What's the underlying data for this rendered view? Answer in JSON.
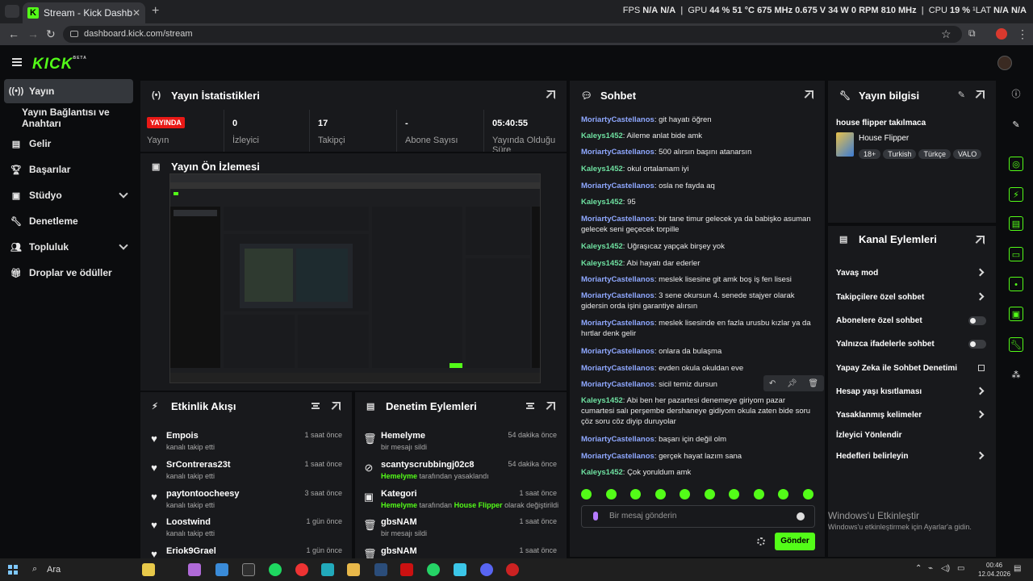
{
  "browser": {
    "tab_title": "Stream - Kick Dashboard",
    "tab_icon": "K",
    "url": "dashboard.kick.com/stream",
    "overlay": {
      "fps_label": "FPS",
      "fps": "N/A",
      "fps2": "N/A",
      "gpu_label": "GPU",
      "gpu_load": "44 %",
      "gpu_temp": "51 °C",
      "gpu_clock": "675 MHz",
      "gpu_volt": "0.675 V",
      "gpu_power": "34 W",
      "gpu_fan": "0 RPM",
      "gpu_mem": "810 MHz",
      "cpu_label": "CPU",
      "cpu_load": "19 %",
      "cpu_lat": "¹LAT",
      "cpu_na1": "N/A",
      "cpu_na2": "N/A"
    }
  },
  "app": {
    "logo": "KICK",
    "logo_beta": "BETA"
  },
  "sidebar": {
    "items": [
      {
        "label": "Yayın",
        "icon": "broadcast-icon"
      },
      {
        "label": "Yayın Bağlantısı ve Anahtarı",
        "icon": ""
      },
      {
        "label": "Gelir",
        "icon": "revenue-icon"
      },
      {
        "label": "Başarılar",
        "icon": "trophy-icon"
      },
      {
        "label": "Stüdyo",
        "icon": "studio-icon"
      },
      {
        "label": "Denetleme",
        "icon": "wrench-icon"
      },
      {
        "label": "Topluluk",
        "icon": "community-icon"
      },
      {
        "label": "Droplar ve ödüller",
        "icon": "gift-icon"
      }
    ]
  },
  "stats": {
    "title": "Yayın İstatistikleri",
    "live_badge": "YAYINDA",
    "live_label": "Yayın",
    "items": [
      {
        "value": "0",
        "label": "İzleyici"
      },
      {
        "value": "17",
        "label": "Takipçi"
      },
      {
        "value": "-",
        "label": "Abone Sayısı"
      },
      {
        "value": "05:40:55",
        "label": "Yayında Olduğu Süre"
      }
    ]
  },
  "preview": {
    "title": "Yayın Ön İzlemesi"
  },
  "activity": {
    "title": "Etkinlik Akışı",
    "items": [
      {
        "name": "Empois",
        "sub": "kanalı takip etti",
        "time": "1 saat önce"
      },
      {
        "name": "SrContreras23t",
        "sub": "kanalı takip etti",
        "time": "1 saat önce"
      },
      {
        "name": "paytontoocheesy",
        "sub": "kanalı takip etti",
        "time": "3 saat önce"
      },
      {
        "name": "Loostwind",
        "sub": "kanalı takip etti",
        "time": "1 gün önce"
      },
      {
        "name": "Eriok9Grael",
        "sub": "",
        "time": "1 gün önce"
      }
    ]
  },
  "moderation": {
    "title": "Denetim Eylemleri",
    "items": [
      {
        "name": "Hemelyme",
        "pre": "",
        "hl1": "",
        "mid": "bir mesajı sildi",
        "hl2": "",
        "post": "",
        "time": "54 dakika önce"
      },
      {
        "name": "scantyscrubbingj02c8",
        "pre": "",
        "hl1": "Hemelyme",
        "mid": " tarafından yasaklandı",
        "hl2": "",
        "post": "",
        "time": "54 dakika önce"
      },
      {
        "name": "Kategori",
        "pre": "",
        "hl1": "Hemelyme",
        "mid": " tarafından ",
        "hl2": "House Flipper",
        "post": " olarak değiştirildi",
        "time": "1 saat önce"
      },
      {
        "name": "gbsNAM",
        "pre": "",
        "hl1": "",
        "mid": "bir mesajı sildi",
        "hl2": "",
        "post": "",
        "time": "1 saat önce"
      },
      {
        "name": "gbsNAM",
        "pre": "",
        "hl1": "",
        "mid": "",
        "hl2": "",
        "post": "",
        "time": "1 saat önce"
      }
    ]
  },
  "chat": {
    "title": "Sohbet",
    "messages": [
      {
        "user": "MoriartyCastellanos",
        "text": "git hayatı öğren",
        "c": "u1"
      },
      {
        "user": "Kaleys1452",
        "text": "Aileme anlat bide amk",
        "c": "u2"
      },
      {
        "user": "MoriartyCastellanos",
        "text": "500 alırsın başını atanarsın",
        "c": "u1"
      },
      {
        "user": "Kaleys1452",
        "text": "okul ortalamam iyi",
        "c": "u2"
      },
      {
        "user": "MoriartyCastellanos",
        "text": "osla ne fayda aq",
        "c": "u1"
      },
      {
        "user": "Kaleys1452",
        "text": "95",
        "c": "u2"
      },
      {
        "user": "MoriartyCastellanos",
        "text": "bir tane timur gelecek ya da babişko asuman gelecek seni geçecek torpille",
        "c": "u1"
      },
      {
        "user": "Kaleys1452",
        "text": "Uğraşıcaz yapçak birşey yok",
        "c": "u2"
      },
      {
        "user": "Kaleys1452",
        "text": "Abi hayatı dar ederler",
        "c": "u2"
      },
      {
        "user": "MoriartyCastellanos",
        "text": "meslek lisesine git amk boş iş fen lisesi",
        "c": "u1"
      },
      {
        "user": "MoriartyCastellanos",
        "text": "3 sene okursun 4. senede stajyer olarak gidersin orda işini garantiye alırsın",
        "c": "u1"
      },
      {
        "user": "MoriartyCastellanos",
        "text": "meslek lisesinde en fazla urusbu kızlar ya da hırtlar denk gelir",
        "c": "u1"
      },
      {
        "user": "MoriartyCastellanos",
        "text": "onlara da bulaşma",
        "c": "u1"
      },
      {
        "user": "MoriartyCastellanos",
        "text": "evden okula okuldan eve",
        "c": "u1"
      },
      {
        "user": "MoriartyCastellanos",
        "text": "sicil temiz dursun",
        "c": "u1"
      },
      {
        "user": "Kaleys1452",
        "text": "Abi ben her pazartesi denemeye giriyom pazar cumartesi salı perşembe dershaneye gidiyom okula zaten bide soru çöz soru cöz diyip duruyolar",
        "c": "u2"
      },
      {
        "user": "MoriartyCastellanos",
        "text": "başarı için değil olm",
        "c": "u1"
      },
      {
        "user": "MoriartyCastellanos",
        "text": "gerçek hayat lazım sana",
        "c": "u1"
      },
      {
        "user": "Kaleys1452",
        "text": "Çok yoruldum amk",
        "c": "u2"
      }
    ],
    "input_placeholder": "Bir mesaj gönderin",
    "send_label": "Gönder"
  },
  "stream_info": {
    "title": "Yayın bilgisi",
    "stream_title": "house flipper takılmaca",
    "category": "House Flipper",
    "tags": [
      "18+",
      "Turkish",
      "Türkçe",
      "VALO"
    ]
  },
  "channel_actions": {
    "title": "Kanal Eylemleri",
    "items": [
      {
        "label": "Yavaş mod",
        "type": "chevron"
      },
      {
        "label": "Takipçilere özel sohbet",
        "type": "chevron"
      },
      {
        "label": "Abonelere özel sohbet",
        "type": "toggle"
      },
      {
        "label": "Yalnızca ifadelerle sohbet",
        "type": "toggle"
      },
      {
        "label": "Yapay Zeka ile Sohbet Denetimi",
        "type": "link"
      },
      {
        "label": "Hesap yaşı kısıtlaması",
        "type": "chevron"
      },
      {
        "label": "Yasaklanmış kelimeler",
        "type": "chevron"
      },
      {
        "label": "İzleyici Yönlendir",
        "type": "none"
      },
      {
        "label": "Hedefleri belirleyin",
        "type": "chevron"
      }
    ]
  },
  "windows": {
    "watermark_title": "Windows'u Etkinleştir",
    "watermark_sub": "Windows'u etkinleştirmek için Ayarlar'a gidin.",
    "search": "Ara",
    "time": "00:46",
    "date": "12.04.2026"
  }
}
